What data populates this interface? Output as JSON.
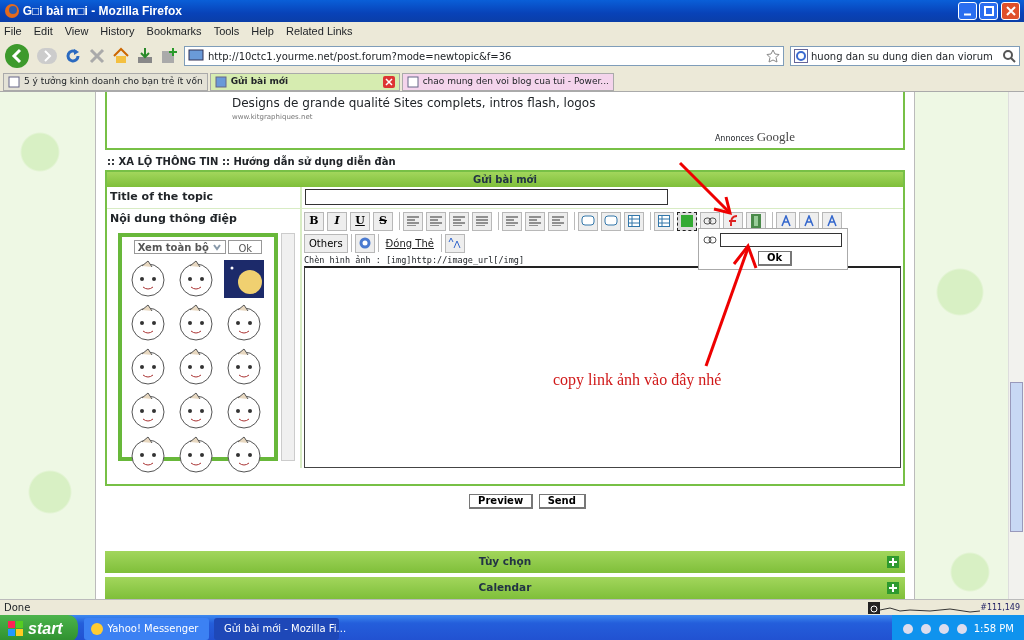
{
  "window": {
    "title": "G□i bài m□i - Mozilla Firefox"
  },
  "menu": [
    "File",
    "Edit",
    "View",
    "History",
    "Bookmarks",
    "Tools",
    "Help",
    "Related Links"
  ],
  "address": "http://10ctc1.yourme.net/post.forum?mode=newtopic&f=36",
  "search": "huong dan su dung dien dan viorum",
  "tabs": [
    {
      "label": "5 ý tưởng kinh doanh cho bạn trẻ ít vốn",
      "selected": false
    },
    {
      "label": "Gửi bài mới",
      "selected": true
    },
    {
      "label": "chao mung den voi blog cua tui - Power...",
      "selected": false
    }
  ],
  "ad": {
    "text": "Designs de grande qualité Sites complets, intros flash, logos",
    "url": "www.kitgraphiques.net",
    "attribution_prefix": "Annonces",
    "attribution": "Google"
  },
  "breadcrumb": ":: XA LỘ THÔNG TIN :: Hướng dẫn sử dụng diễn đàn",
  "form": {
    "header": "Gửi bài mới",
    "title_label": "Title of the topic",
    "message_label": "Nội dung thông điệp",
    "smilies": {
      "select": "Xem toàn bộ",
      "ok": "Ok"
    },
    "toolbar": [
      [
        {
          "kind": "letter",
          "label": "B",
          "selected": false
        },
        {
          "kind": "letter",
          "label": "I",
          "selected": false
        },
        {
          "kind": "letter",
          "label": "U",
          "selected": false
        },
        {
          "kind": "letter",
          "label": "S",
          "selected": false
        }
      ],
      [
        {
          "kind": "align-left",
          "selected": false
        },
        {
          "kind": "align-center",
          "selected": false
        },
        {
          "kind": "align-right",
          "selected": false
        },
        {
          "kind": "justify",
          "selected": false
        }
      ],
      [
        {
          "kind": "list",
          "selected": false
        },
        {
          "kind": "numbered-list",
          "selected": false
        },
        {
          "kind": "rule",
          "selected": false
        }
      ],
      [
        {
          "kind": "quote",
          "selected": false
        },
        {
          "kind": "code",
          "selected": false
        },
        {
          "kind": "table",
          "selected": false
        }
      ],
      [
        {
          "kind": "copy",
          "selected": false
        },
        {
          "kind": "image",
          "selected": true
        },
        {
          "kind": "link",
          "selected": false
        },
        {
          "kind": "flash",
          "selected": false
        },
        {
          "kind": "film",
          "selected": false
        }
      ],
      [
        {
          "kind": "font",
          "selected": false
        },
        {
          "kind": "palette",
          "selected": false
        },
        {
          "kind": "italic-a",
          "selected": false
        }
      ]
    ],
    "others": "Others",
    "close_tags": "Đóng Thẻ",
    "hint": "Chèn hình ảnh : [img]http://image_url[/img]",
    "popup": {
      "ok": "Ok"
    },
    "annotation": "copy link ảnh vào đây nhé",
    "buttons": [
      "Preview",
      "Send"
    ]
  },
  "sections": [
    {
      "title": "Tùy chọn",
      "expanded": false
    },
    {
      "title": "Calendar",
      "expanded": false
    }
  ],
  "status_bar": {
    "text": "Done",
    "rank": "#111,149"
  },
  "taskbar": {
    "start": "start",
    "items": [
      {
        "label": "Yahoo! Messenger",
        "selected": false
      },
      {
        "label": "Gửi bài mới - Mozilla Fi...",
        "selected": true
      }
    ],
    "clock": "1:58 PM"
  }
}
